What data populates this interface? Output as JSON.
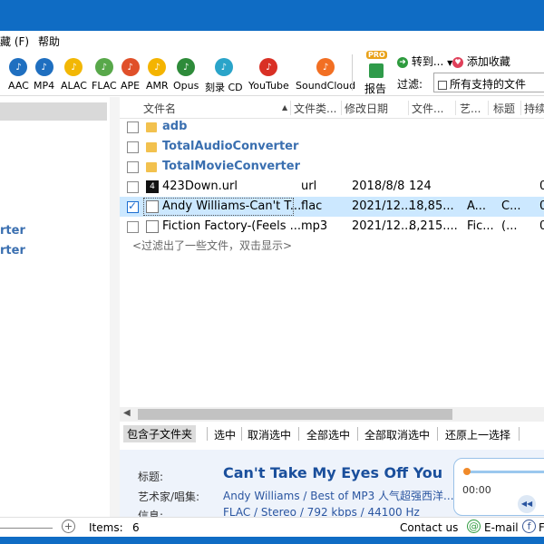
{
  "menu": {
    "favorites": "藏 (F)",
    "help": "帮助"
  },
  "toolbar": {
    "formats": [
      {
        "label": "AAC",
        "icon": "aac-icon",
        "color": "#1f6fc0"
      },
      {
        "label": "MP4",
        "icon": "mp4-icon",
        "color": "#1f6fc0"
      },
      {
        "label": "ALAC",
        "icon": "alac-icon",
        "color": "#f2b705"
      },
      {
        "label": "FLAC",
        "icon": "flac-icon",
        "color": "#58a84a"
      },
      {
        "label": "APE",
        "icon": "ape-icon",
        "color": "#e0502a"
      },
      {
        "label": "AMR",
        "icon": "amr-icon",
        "color": "#f4b400"
      },
      {
        "label": "Opus",
        "icon": "opus-icon",
        "color": "#2e8b3a"
      },
      {
        "label": "刻录 CD",
        "icon": "burn-cd-icon",
        "color": "#2aa4c9"
      },
      {
        "label": "YouTube",
        "icon": "youtube-icon",
        "color": "#d93025"
      },
      {
        "label": "SoundCloud",
        "icon": "soundcloud-icon",
        "color": "#f26f23"
      }
    ],
    "report": "报告",
    "report_badge": "PRO",
    "goto": "转到...",
    "add_favorite": "添加收藏",
    "filter_label": "过滤:",
    "filter_value": "所有支持的文件"
  },
  "left": {
    "item1": "rter",
    "item2": "rter"
  },
  "columns": [
    "文件名",
    "文件类...",
    "修改日期",
    "文件...",
    "艺...",
    "标题",
    "持续"
  ],
  "rows": [
    {
      "type": "folder",
      "name": "adb",
      "ext": "",
      "date": "",
      "size": "",
      "artist": "",
      "title": "",
      "dur": "",
      "checked": false
    },
    {
      "type": "folder",
      "name": "TotalAudioConverter",
      "ext": "",
      "date": "",
      "size": "",
      "artist": "",
      "title": "",
      "dur": "",
      "checked": false
    },
    {
      "type": "folder",
      "name": "TotalMovieConverter",
      "ext": "",
      "date": "",
      "size": "",
      "artist": "",
      "title": "",
      "dur": "",
      "checked": false
    },
    {
      "type": "url",
      "name": "423Down.url",
      "ext": "url",
      "date": "2018/8/8",
      "size": "124",
      "artist": "",
      "title": "",
      "dur": "0",
      "checked": false
    },
    {
      "type": "doc",
      "name": "Andy Williams-Can't T...",
      "ext": "flac",
      "date": "2021/12...",
      "size": "18,85...",
      "artist": "A...",
      "title": "C...",
      "dur": "0",
      "checked": true
    },
    {
      "type": "doc",
      "name": "Fiction Factory-(Feels ...",
      "ext": "mp3",
      "date": "2021/12...",
      "size": "8,215....",
      "artist": "Fic...",
      "title": "(...",
      "dur": "0",
      "checked": false
    }
  ],
  "filtered_note": "<过滤出了一些文件，双击显示>",
  "actions": [
    "包含子文件夹",
    "选中",
    "取消选中",
    "全部选中",
    "全部取消选中",
    "还原上一选择"
  ],
  "info": {
    "title_label": "标题:",
    "title_value": "Can't Take My Eyes Off You",
    "artist_label": "艺术家/唱集:",
    "artist_value": "Andy Williams / Best of MP3 人气超强西洋...",
    "info_label": "信息:",
    "info_value": "FLAC / Stereo / 792 kbps / 44100 Hz"
  },
  "player": {
    "time": "00:00",
    "progress": 0.0
  },
  "status": {
    "items_label": "Items:",
    "items_count": "6",
    "contact": "Contact us",
    "email": "E-mail",
    "facebook": "F"
  }
}
